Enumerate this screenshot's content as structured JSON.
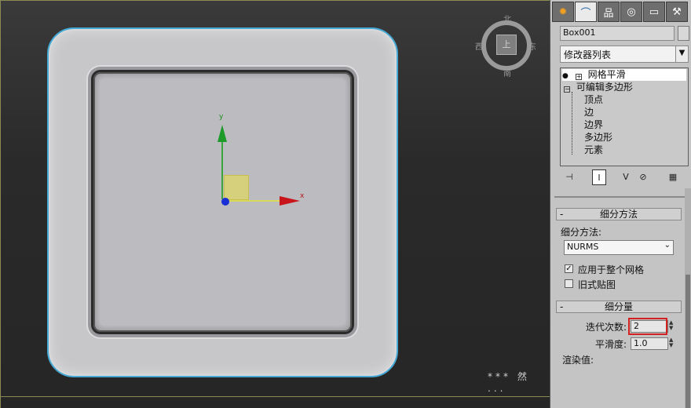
{
  "viewport": {
    "gizmo": {
      "y_label": "y",
      "x_label": "x"
    },
    "viewcube": {
      "north": "北",
      "south": "南",
      "east": "东",
      "west": "西",
      "face": "上"
    },
    "watermark": "*** 然 ..."
  },
  "panel": {
    "tabs": [
      {
        "icon": "create-icon",
        "glyph": "✹"
      },
      {
        "icon": "modify-icon",
        "glyph": "⌒"
      },
      {
        "icon": "hierarchy-icon",
        "glyph": "品"
      },
      {
        "icon": "motion-icon",
        "glyph": "◎"
      },
      {
        "icon": "display-icon",
        "glyph": "▭"
      },
      {
        "icon": "utilities-icon",
        "glyph": "⚒"
      }
    ],
    "object_name": "Box001",
    "modifier_list": "修改器列表",
    "stack": {
      "meshsmooth": "网格平滑",
      "edit_poly": "可编辑多边形",
      "subobjects": [
        "顶点",
        "边",
        "边界",
        "多边形",
        "元素"
      ]
    },
    "subdivision_method_rollout": {
      "title": "细分方法",
      "method_label": "细分方法:",
      "method_value": "NURMS",
      "apply_whole_mesh": "应用于整个网格",
      "apply_whole_mesh_checked": true,
      "old_style_mapping": "旧式贴图",
      "old_style_mapping_checked": false
    },
    "subdivision_amount_rollout": {
      "title": "细分量",
      "iterations_label": "迭代次数:",
      "iterations_value": "2",
      "smoothness_label": "平滑度:",
      "smoothness_value": "1.0",
      "render_values_label": "渲染值:"
    }
  }
}
